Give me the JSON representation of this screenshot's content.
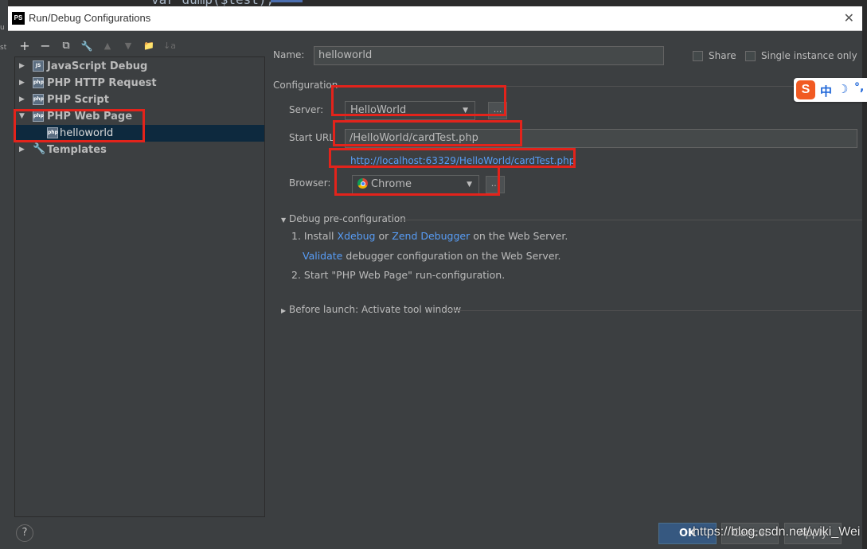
{
  "window": {
    "app_icon": "PS",
    "title": "Run/Debug Configurations",
    "close": "✕"
  },
  "ide_background": {
    "code_snippet": "var_dump($test);"
  },
  "toolbar": {
    "add": "+",
    "remove": "−",
    "copy": "⧉",
    "edit_defaults": "🔧",
    "move_up": "▲",
    "move_down": "▼",
    "folder": "📁",
    "sort": "↓a"
  },
  "tree": {
    "items": [
      {
        "label": "JavaScript Debug",
        "icon": "js-debug-icon"
      },
      {
        "label": "PHP HTTP Request",
        "icon": "php-http-request-icon"
      },
      {
        "label": "PHP Script",
        "icon": "php-script-icon"
      },
      {
        "label": "PHP Web Page",
        "icon": "php-web-page-icon",
        "expanded": true
      },
      {
        "label": "helloworld",
        "icon": "php-web-page-icon",
        "selected": true
      },
      {
        "label": "Templates",
        "icon": "wrench-icon"
      }
    ]
  },
  "form": {
    "name_label": "Name:",
    "name_value": "helloworld",
    "share_label": "Share",
    "single_instance_label": "Single instance only",
    "configuration_label": "Configuration",
    "server_label": "Server:",
    "server_value": "HelloWorld",
    "browse_label": "...",
    "start_url_label": "Start URL",
    "start_url_value": "/HelloWorld/cardTest.php",
    "full_url": "http://localhost:63329/HelloWorld/cardTest.php",
    "browser_label": "Browser:",
    "browser_value": "Chrome"
  },
  "debug_pre": {
    "header": "Debug pre-configuration",
    "step1_prefix": "1. Install",
    "xdebug": "Xdebug",
    "or": "or",
    "zend": "Zend Debugger",
    "step1_suffix": "on the Web Server.",
    "validate": "Validate",
    "validate_suffix": "debugger configuration on the Web Server.",
    "step2": "2. Start \"PHP Web Page\" run-configuration."
  },
  "before_launch": {
    "header": "Before launch: Activate tool window"
  },
  "ime": {
    "logo": "S",
    "lang": "中",
    "moon": "☽",
    "punct": "°,"
  },
  "footer": {
    "help": "?",
    "ok": "OK",
    "cancel": "Cancel",
    "apply": "Apply",
    "watermark": "https://blog.csdn.net/wiki_Wei"
  }
}
